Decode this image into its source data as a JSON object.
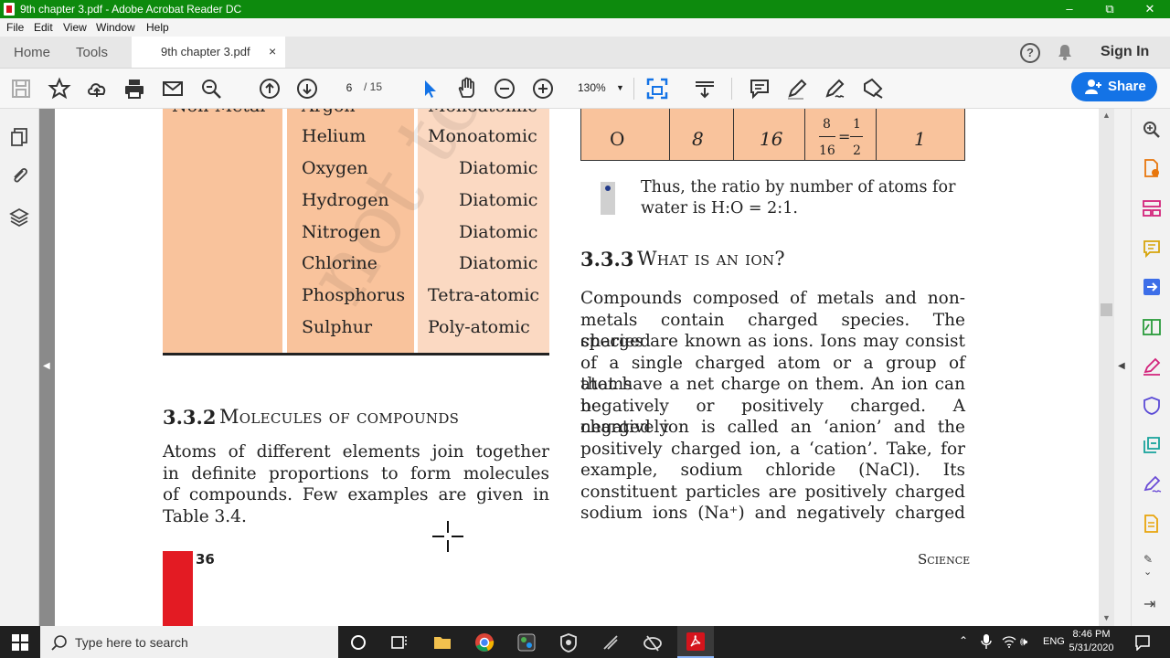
{
  "window": {
    "title": "9th chapter 3.pdf - Adobe Acrobat Reader DC",
    "minimize": "–",
    "maximize": "⧉",
    "close": "✕"
  },
  "menu": [
    "File",
    "Edit",
    "View",
    "Window",
    "Help"
  ],
  "tabs": {
    "home": "Home",
    "tools": "Tools",
    "document": "9th chapter 3.pdf",
    "close": "×"
  },
  "header": {
    "help": "?",
    "sign_in": "Sign In"
  },
  "toolbar": {
    "current_page": "6",
    "total_pages": "/ 15",
    "zoom": "130%",
    "share_label": "Share"
  },
  "document": {
    "table_top": {
      "row_partial": {
        "c1": "Non-Metal",
        "c2": "Argon",
        "c3": "Monoatomic"
      },
      "rows": [
        {
          "element": "Helium",
          "atomicity": "Monoatomic"
        },
        {
          "element": "Oxygen",
          "atomicity": "Diatomic"
        },
        {
          "element": "Hydrogen",
          "atomicity": "Diatomic"
        },
        {
          "element": "Nitrogen",
          "atomicity": "Diatomic"
        },
        {
          "element": "Chlorine",
          "atomicity": "Diatomic"
        },
        {
          "element": "Phosphorus",
          "atomicity": "Tetra-atomic"
        },
        {
          "element": "Sulphur",
          "atomicity": "Poly-atomic"
        }
      ]
    },
    "table_right": {
      "element": "O",
      "mass": "8",
      "molar": "16",
      "ratio_num1": "8",
      "ratio_den1": "16",
      "eq": "=",
      "ratio_num2": "1",
      "ratio_den2": "2",
      "simple": "1"
    },
    "bullet_text": [
      "Thus, the ratio by number of atoms for",
      "water is H:O = 2:1."
    ],
    "section_332_num": "3.3.2",
    "section_332_title": "Molecules of compounds",
    "para_332": [
      "Atoms of different elements join together",
      "in definite proportions to form molecules",
      "of compounds. Few examples are given in",
      "Table 3.4."
    ],
    "section_333_num": "3.3.3",
    "section_333_title": "What is an ion?",
    "para_333": [
      "Compounds composed of metals and non-",
      "metals contain charged species. The charged",
      "species are known as ions. Ions may consist",
      "of a single charged atom or a group of atoms",
      "that have a net charge on them. An ion can be",
      "negatively or positively charged. A negatively",
      "charged ion is called an ‘anion’ and the",
      "positively charged ion, a ‘cation’. Take, for",
      "example, sodium chloride (NaCl). Its",
      "constituent particles are positively charged",
      "sodium ions (Na⁺) and negatively charged"
    ],
    "page_number": "36",
    "footer_right": "Science",
    "watermark": "not to be"
  },
  "taskbar": {
    "search_placeholder": "Type here to search",
    "lang": "ENG",
    "time": "8:46 PM",
    "date": "5/31/2020"
  },
  "colors": {
    "titlebar": "#0d8a0d",
    "table_fill": "#f9c39c",
    "table_fill_light": "#fbd9c2",
    "share": "#1473e6",
    "page_tab": "#e31b23"
  }
}
